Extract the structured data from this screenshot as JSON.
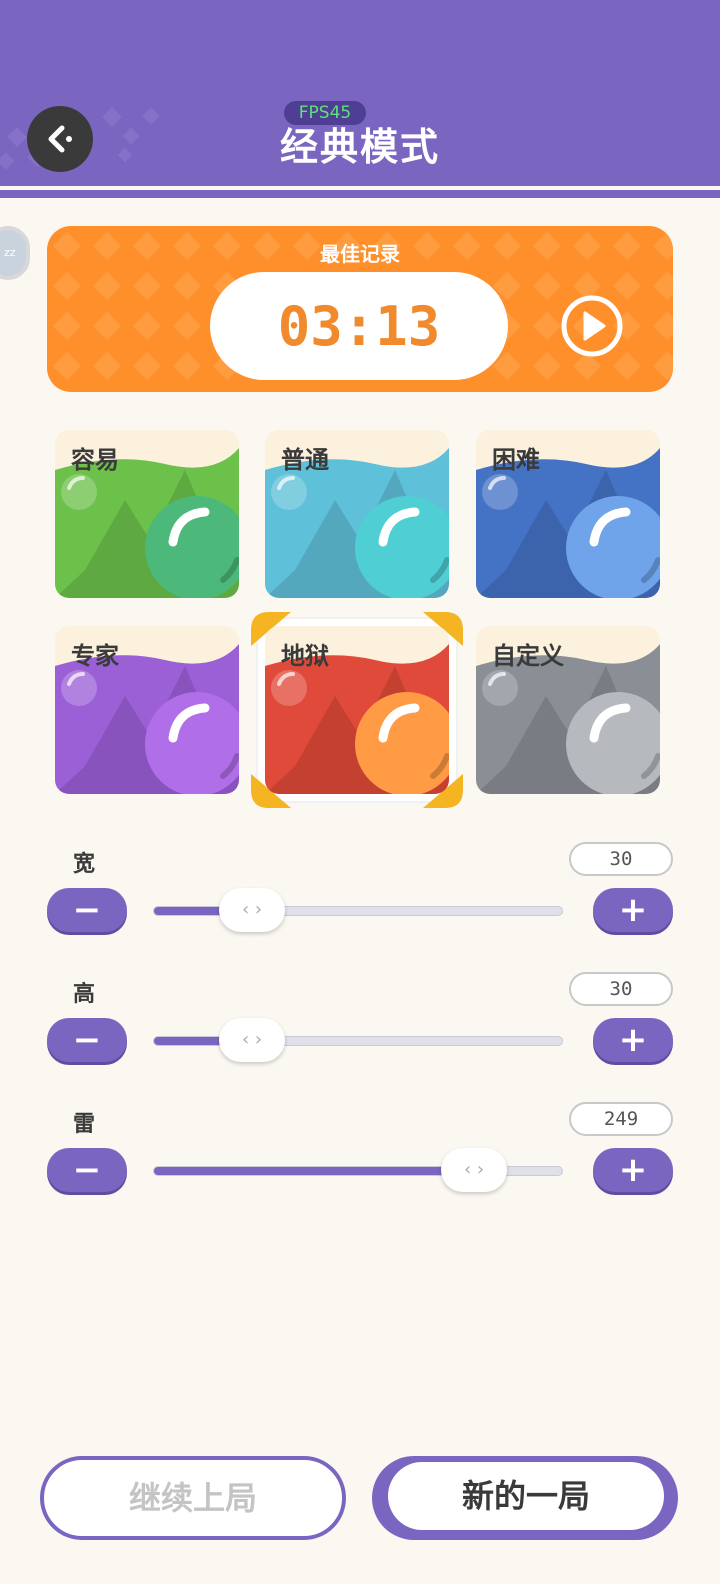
{
  "header": {
    "title": "经典模式",
    "fps": "FPS45",
    "back_icon": "back-arrow-icon",
    "color": "#7a66c1"
  },
  "record": {
    "label": "最佳记录",
    "time": "03:13",
    "play_icon": "play-icon",
    "color": "#ff8f2a"
  },
  "difficulties": [
    {
      "label": "容易",
      "color": "#6cc14a",
      "ball": "#4cb97a"
    },
    {
      "label": "普通",
      "color": "#5fc0d9",
      "ball": "#4fcfd3"
    },
    {
      "label": "困难",
      "color": "#4472c4",
      "ball": "#6fa3ea"
    },
    {
      "label": "专家",
      "color": "#9b5fd6",
      "ball": "#b06fe8"
    },
    {
      "label": "地狱",
      "color": "#e04a3a",
      "ball": "#ff9a45",
      "selected": true
    },
    {
      "label": "自定义",
      "color": "#8a8f96",
      "ball": "#b6babf"
    }
  ],
  "sliders": [
    {
      "label": "宽",
      "value": "30",
      "fraction": 0.24
    },
    {
      "label": "高",
      "value": "30",
      "fraction": 0.24
    },
    {
      "label": "雷",
      "value": "249",
      "fraction": 0.78
    }
  ],
  "controls": {
    "minus": "−",
    "plus": "+",
    "thumb": "‹ ›"
  },
  "footer": {
    "continue_label": "继续上局",
    "new_label": "新的一局"
  }
}
